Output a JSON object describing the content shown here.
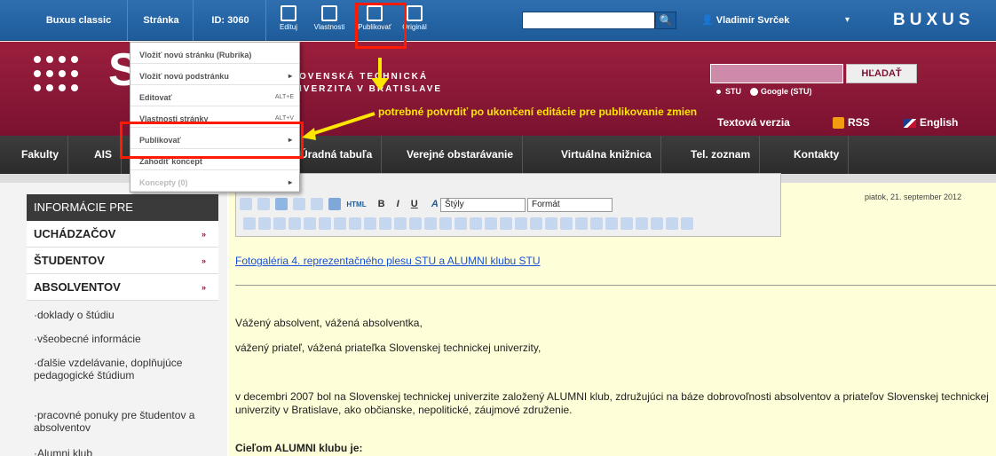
{
  "topbar": {
    "items": [
      "Buxus classic",
      "Stránka",
      "ID: 3060"
    ],
    "tools": [
      {
        "label": "Edituj",
        "icon": "edit-icon"
      },
      {
        "label": "Vlastnosti",
        "icon": "properties-icon"
      },
      {
        "label": "Publikovať",
        "icon": "publish-icon"
      },
      {
        "label": "Originál",
        "icon": "original-icon"
      }
    ],
    "search_placeholder": "",
    "search_icon": "🔍",
    "user": "Vladimír Svrček",
    "user_icon": "👤",
    "caret": "▾",
    "logo": "BUXUS"
  },
  "header": {
    "logo_letter": "S",
    "university_line1": "OVENSKÁ TECHNICKÁ",
    "university_line2": "IVERZITA V BRATISLAVE",
    "search_button": "HĽADAŤ",
    "radio_stu": "STU",
    "radio_google": "Google (STU)",
    "text_version": "Textová verzia",
    "rss": "RSS",
    "english": "English",
    "annotation": "potrebné potvrdiť po ukončení editácie pre publikovanie zmien"
  },
  "nav": {
    "items": [
      "Fakulty",
      "AIS",
      "Úradná tabuľa",
      "Verejné obstarávanie",
      "Virtuálna knižnica",
      "Tel. zoznam",
      "Kontakty"
    ]
  },
  "menu": {
    "items": [
      {
        "label": "Vložiť novú stránku (Rubrika)",
        "shortcut": "",
        "arrow": false,
        "disabled": false
      },
      {
        "label": "Vložiť novú podstránku",
        "shortcut": "",
        "arrow": true,
        "disabled": false
      },
      {
        "label": "Editovať",
        "shortcut": "ALT+E",
        "arrow": false,
        "disabled": false
      },
      {
        "label": "Vlastnosti stránky",
        "shortcut": "ALT+V",
        "arrow": false,
        "disabled": false
      },
      {
        "label": "Publikovať",
        "shortcut": "",
        "arrow": true,
        "disabled": false
      },
      {
        "label": "Zahodiť koncept",
        "shortcut": "",
        "arrow": false,
        "disabled": false
      },
      {
        "label": "Koncepty (0)",
        "shortcut": "",
        "arrow": true,
        "disabled": true
      }
    ]
  },
  "editor": {
    "html_label": "HTML",
    "style_select": "Štýly",
    "format_select": "Formát"
  },
  "date": "piatok, 21. september 2012",
  "sidebar": {
    "title": "INFORMÁCIE PRE",
    "sections": [
      "UCHÁDZAČOV",
      "ŠTUDENTOV",
      "ABSOLVENTOV"
    ],
    "arrow": "»",
    "subitems": [
      "doklady o štúdiu",
      "všeobecné informácie",
      "ďalšie vzdelávanie, doplňujúce pedagogické štúdium",
      "pracovné ponuky pre študentov a absolventov",
      "Alumni klub"
    ]
  },
  "content": {
    "link": "Fotogaléria 4. reprezentačného plesu STU a ALUMNI klubu STU",
    "p1": "Vážený absolvent, vážená absolventka,",
    "p2": "vážený priateľ, vážená priateľka Slovenskej technickej univerzity,",
    "p3": "v decembri 2007 bol na Slovenskej technickej univerzite založený ALUMNI  klub, združujúci  na báze dobrovoľnosti absolventov a priateľov Slovenskej technickej univerzity v Bratislave, ako občianske, nepolitické, záujmové  združenie.",
    "p4": "Cieľom  ALUMNI klubu je:"
  }
}
